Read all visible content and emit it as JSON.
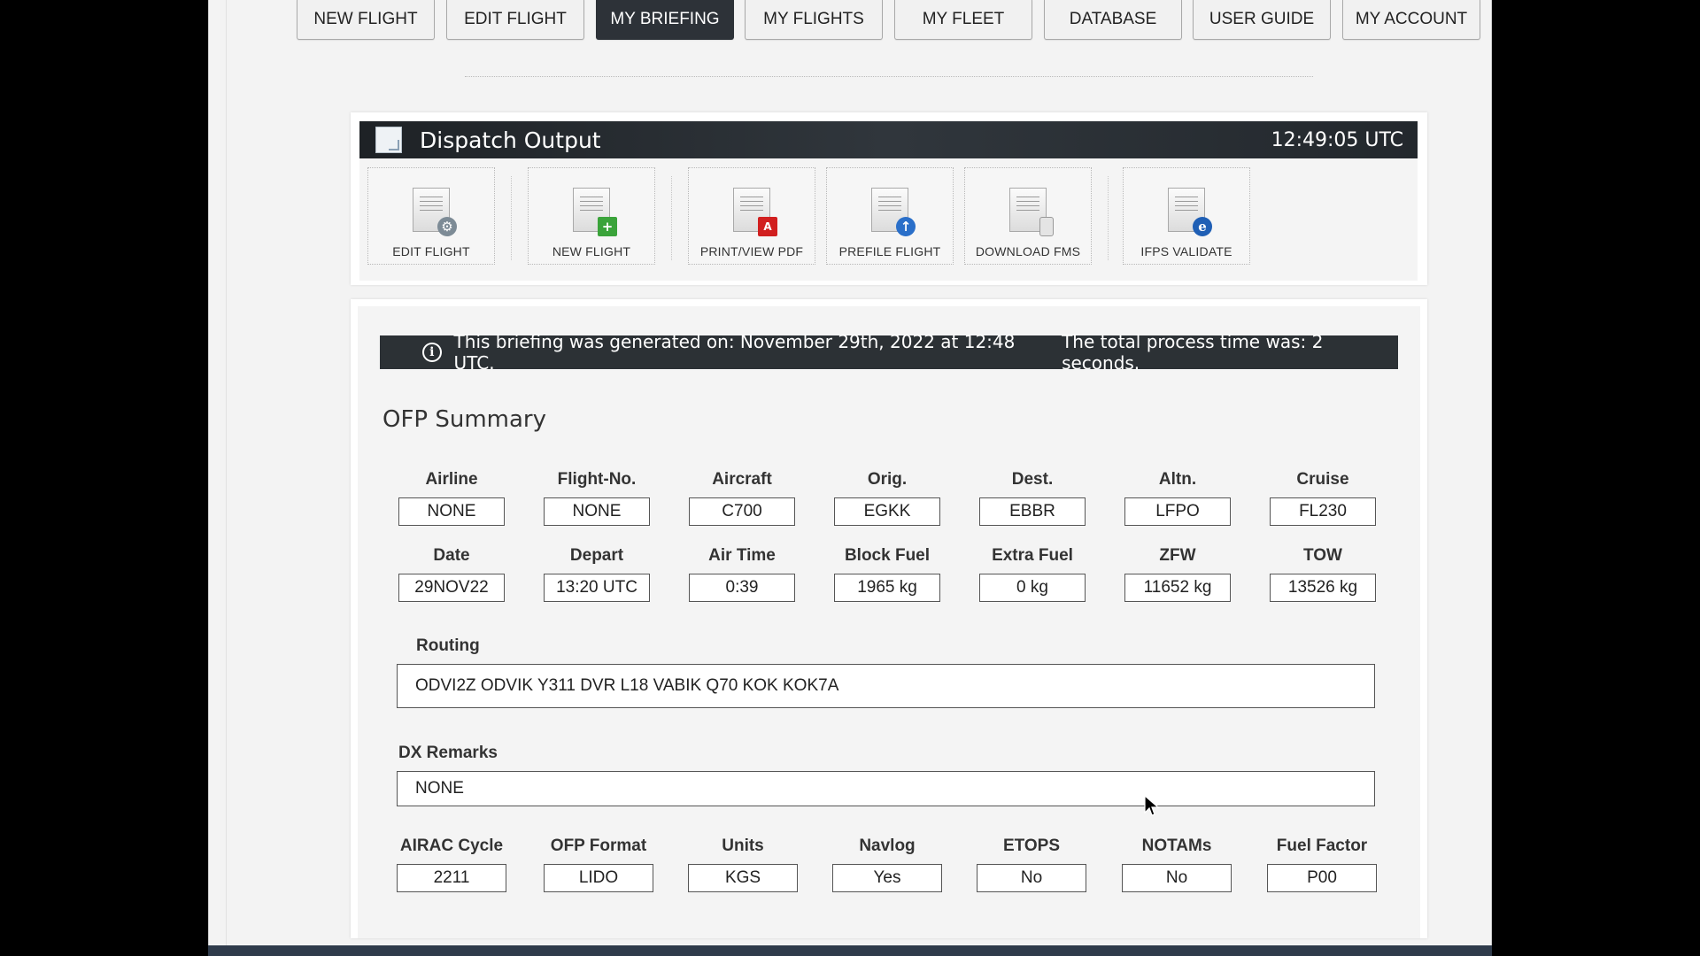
{
  "nav": {
    "tabs": [
      {
        "label": "NEW FLIGHT"
      },
      {
        "label": "EDIT FLIGHT"
      },
      {
        "label": "MY BRIEFING",
        "active": true
      },
      {
        "label": "MY FLIGHTS"
      },
      {
        "label": "MY FLEET"
      },
      {
        "label": "DATABASE"
      },
      {
        "label": "USER GUIDE"
      },
      {
        "label": "MY ACCOUNT"
      }
    ]
  },
  "dispatch": {
    "title": "Dispatch Output",
    "time": "12:49:05 UTC",
    "tools": [
      {
        "label": "EDIT FLIGHT",
        "icon": "gear-icon"
      },
      {
        "label": "NEW FLIGHT",
        "icon": "plus-icon"
      },
      {
        "label": "PRINT/VIEW PDF",
        "icon": "pdf-icon"
      },
      {
        "label": "PREFILE FLIGHT",
        "icon": "upload-icon"
      },
      {
        "label": "DOWNLOAD FMS",
        "icon": "device-icon"
      },
      {
        "label": "IFPS VALIDATE",
        "icon": "validate-icon"
      }
    ]
  },
  "briefing": {
    "info_generated": "This briefing was generated on: November 29th, 2022 at 12:48 UTC.",
    "info_process": "The total process time was: 2 seconds.",
    "section_title": "OFP Summary",
    "row1": [
      {
        "label": "Airline",
        "value": "NONE"
      },
      {
        "label": "Flight-No.",
        "value": "NONE"
      },
      {
        "label": "Aircraft",
        "value": "C700"
      },
      {
        "label": "Orig.",
        "value": "EGKK"
      },
      {
        "label": "Dest.",
        "value": "EBBR"
      },
      {
        "label": "Altn.",
        "value": "LFPO"
      },
      {
        "label": "Cruise",
        "value": "FL230"
      }
    ],
    "row2": [
      {
        "label": "Date",
        "value": "29NOV22"
      },
      {
        "label": "Depart",
        "value": "13:20 UTC"
      },
      {
        "label": "Air Time",
        "value": "0:39"
      },
      {
        "label": "Block Fuel",
        "value": "1965 kg"
      },
      {
        "label": "Extra Fuel",
        "value": "0 kg"
      },
      {
        "label": "ZFW",
        "value": "11652 kg"
      },
      {
        "label": "TOW",
        "value": "13526 kg"
      }
    ],
    "routing_label": "Routing",
    "routing_value": "ODVI2Z ODVIK Y311 DVR L18 VABIK Q70 KOK KOK7A",
    "remarks_label": "DX Remarks",
    "remarks_value": "NONE",
    "row3": [
      {
        "label": "AIRAC Cycle",
        "value": "2211"
      },
      {
        "label": "OFP Format",
        "value": "LIDO"
      },
      {
        "label": "Units",
        "value": "KGS"
      },
      {
        "label": "Navlog",
        "value": "Yes"
      },
      {
        "label": "ETOPS",
        "value": "No"
      },
      {
        "label": "NOTAMs",
        "value": "No"
      },
      {
        "label": "Fuel Factor",
        "value": "P00"
      }
    ]
  },
  "colors": {
    "active_tab": "#2d3238",
    "header_bar": "#2c3135",
    "page_bg": "#f3f3f3"
  }
}
